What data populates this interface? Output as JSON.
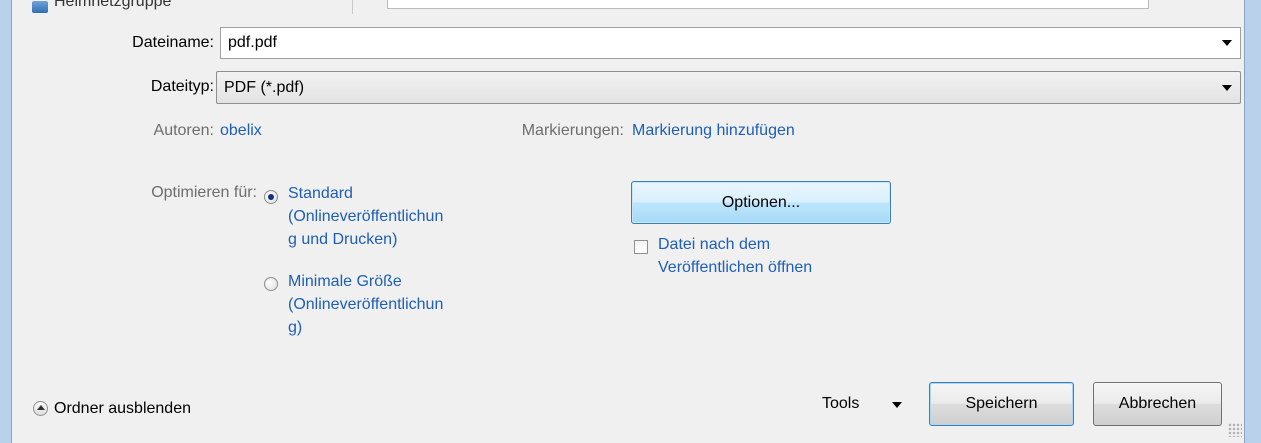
{
  "top_partial": {
    "folder_label": "Heimnetzgruppe"
  },
  "filename": {
    "label": "Dateiname:",
    "value": "pdf.pdf"
  },
  "filetype": {
    "label": "Dateityp:",
    "value": "PDF (*.pdf)"
  },
  "authors": {
    "label": "Autoren:",
    "value": "obelix"
  },
  "tags": {
    "label": "Markierungen:",
    "value": "Markierung hinzufügen"
  },
  "optimize": {
    "label": "Optimieren für:",
    "options": [
      {
        "lines": [
          "Standard",
          "(Onlineveröffentlichun",
          "g und Drucken)"
        ],
        "checked": true
      },
      {
        "lines": [
          "Minimale Größe",
          "(Onlineveröffentlichun",
          "g)"
        ],
        "checked": false
      }
    ]
  },
  "options_button": {
    "label": "Optionen..."
  },
  "open_after": {
    "lines": [
      "Datei nach dem",
      "Veröffentlichen öffnen"
    ],
    "checked": false
  },
  "footer": {
    "hide_folders_label": "Ordner ausblenden",
    "tools_label": "Tools",
    "save_label": "Speichern",
    "cancel_label": "Abbrechen"
  },
  "colors": {
    "link": "#1e5fb4",
    "label_gray": "#6d6d6d",
    "frame": "#b9d1ea"
  }
}
